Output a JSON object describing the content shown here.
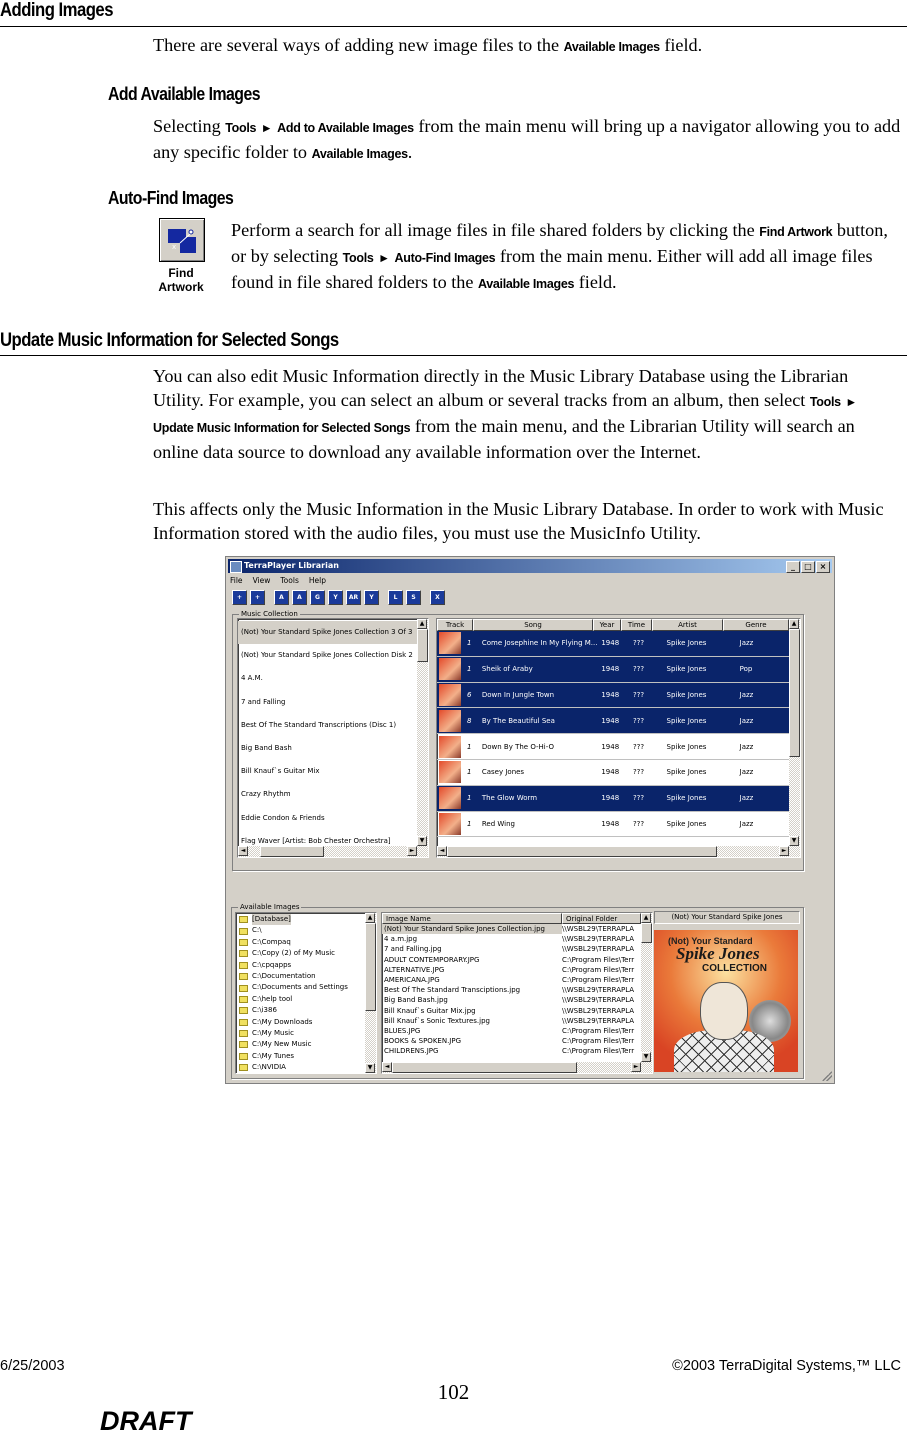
{
  "sections": {
    "adding_images": {
      "heading": "Adding Images",
      "intro_before": "There are several ways of adding new image files to the ",
      "intro_ui": "Available Images",
      "intro_after": " field."
    },
    "add_available": {
      "heading": "Add Available Images",
      "text1": "Selecting ",
      "ui_tools": "Tools",
      "arrow": "►",
      "ui_item": "Add to Available Images",
      "text2": " from the main menu will bring up a navigator allowing you to add any specific folder to ",
      "ui_target": "Available Images",
      "text3": "."
    },
    "auto_find": {
      "heading": "Auto-Find Images",
      "button_label": "Find Artwork",
      "button_icon": "find-artwork-icon",
      "text1": "Perform a search for all image files in file shared folders by clicking the ",
      "ui_button": "Find Artwork",
      "text2": " button, or by selecting ",
      "ui_tools": "Tools",
      "arrow": "►",
      "ui_item": "Auto-Find Images",
      "text3": " from the main menu.  Either will add all image files found in file shared folders to the ",
      "ui_target": "Available Images",
      "text4": " field."
    },
    "update_music": {
      "heading": "Update Music Information for Selected Songs",
      "p1_a": "You can also edit Music Information directly in the Music Library Database using the Librarian Utility.  For example, you can select an album or several tracks from an album, then select ",
      "ui_tools": "Tools",
      "arrow": "►",
      "ui_item": "Update Music Information for Selected Songs",
      "p1_b": " from the main menu, and the Librarian Utility will search an online data source to download any available information over the Internet.",
      "p2": "This affects only the Music Information in the Music Library Database.  In order to work with Music Information stored with the audio files, you must use the MusicInfo Utility."
    }
  },
  "window": {
    "title": "TerraPlayer Librarian",
    "controls": [
      "_",
      "□",
      "×"
    ],
    "menu": [
      "File",
      "View",
      "Tools",
      "Help"
    ],
    "toolbar": [
      "+",
      "+",
      "A",
      "A",
      "G",
      "Y",
      "AR",
      "Y",
      "L",
      "S",
      "X"
    ],
    "music_collection": {
      "label": "Music Collection",
      "items": [
        "(Not) Your Standard Spike Jones Collection 3 Of 3",
        "(Not) Your Standard Spike Jones Collection Disk 2",
        "4 A.M.",
        "7 and Falling",
        "Best Of The Standard Transcriptions (Disc 1)",
        "Big Band Bash",
        "Bill Knauf`s Guitar Mix",
        "Crazy Rhythm",
        "Eddie Condon & Friends",
        "Flag Waver [Artist: Bob Chester Orchestra]"
      ],
      "selected_index": 0
    },
    "tracks": {
      "columns": [
        "Track",
        "Song",
        "Year",
        "Time",
        "Artist",
        "Genre"
      ],
      "rows": [
        {
          "track": "1",
          "song": "Come Josephine In My Flying M...",
          "year": "1948",
          "time": "???",
          "artist": "Spike Jones",
          "genre": "Jazz",
          "selected": true
        },
        {
          "track": "1",
          "song": "Sheik of Araby",
          "year": "1948",
          "time": "???",
          "artist": "Spike Jones",
          "genre": "Pop",
          "selected": true
        },
        {
          "track": "6",
          "song": "Down In Jungle Town",
          "year": "1948",
          "time": "???",
          "artist": "Spike Jones",
          "genre": "Jazz",
          "selected": true
        },
        {
          "track": "8",
          "song": "By The Beautiful Sea",
          "year": "1948",
          "time": "???",
          "artist": "Spike Jones",
          "genre": "Jazz",
          "selected": true
        },
        {
          "track": "1",
          "song": "Down By The O-Hi-O",
          "year": "1948",
          "time": "???",
          "artist": "Spike Jones",
          "genre": "Jazz",
          "selected": false
        },
        {
          "track": "1",
          "song": "Casey Jones",
          "year": "1948",
          "time": "???",
          "artist": "Spike Jones",
          "genre": "Jazz",
          "selected": false
        },
        {
          "track": "1",
          "song": "The Glow Worm",
          "year": "1948",
          "time": "???",
          "artist": "Spike Jones",
          "genre": "Jazz",
          "selected": true
        },
        {
          "track": "1",
          "song": "Red Wing",
          "year": "1948",
          "time": "???",
          "artist": "Spike Jones",
          "genre": "Jazz",
          "selected": false
        }
      ]
    },
    "available_images": {
      "label": "Available Images",
      "folders": [
        "[Database]",
        "C:\\",
        "C:\\Compaq",
        "C:\\Copy (2) of My Music",
        "C:\\cpqapps",
        "C:\\Documentation",
        "C:\\Documents and Settings",
        "C:\\help tool",
        "C:\\i386",
        "C:\\My Downloads",
        "C:\\My Music",
        "C:\\My New Music",
        "C:\\My Tunes",
        "C:\\NVIDIA"
      ],
      "image_columns": [
        "Image Name",
        "Original Folder"
      ],
      "images": [
        {
          "name": "(Not) Your Standard Spike Jones Collection.jpg",
          "folder": "\\\\WSBL29\\TERRAPLA"
        },
        {
          "name": "4 a.m.jpg",
          "folder": "\\\\WSBL29\\TERRAPLA"
        },
        {
          "name": "7 and Falling.jpg",
          "folder": "\\\\WSBL29\\TERRAPLA"
        },
        {
          "name": "ADULT CONTEMPORARY.JPG",
          "folder": "C:\\Program Files\\Terr"
        },
        {
          "name": "ALTERNATIVE.JPG",
          "folder": "C:\\Program Files\\Terr"
        },
        {
          "name": "AMERICANA.JPG",
          "folder": "C:\\Program Files\\Terr"
        },
        {
          "name": "Best Of The Standard Transciptions.jpg",
          "folder": "\\\\WSBL29\\TERRAPLA"
        },
        {
          "name": "Big Band Bash.jpg",
          "folder": "\\\\WSBL29\\TERRAPLA"
        },
        {
          "name": "Bill Knauf`s Guitar Mix.jpg",
          "folder": "\\\\WSBL29\\TERRAPLA"
        },
        {
          "name": "Bill Knauf`s Sonic Textures.jpg",
          "folder": "\\\\WSBL29\\TERRAPLA"
        },
        {
          "name": "BLUES.JPG",
          "folder": "C:\\Program Files\\Terr"
        },
        {
          "name": "BOOKS & SPOKEN.JPG",
          "folder": "C:\\Program Files\\Terr"
        },
        {
          "name": "CHILDRENS.JPG",
          "folder": "C:\\Program Files\\Terr"
        }
      ],
      "preview_title": "(Not) Your Standard Spike Jones",
      "cover": {
        "line1": "(Not) Your Standard",
        "line2": "Spike Jones",
        "line3": "COLLECTION"
      }
    }
  },
  "footer": {
    "date": "6/25/2003",
    "copyright": "©2003 TerraDigital Systems,™ LLC",
    "page": "102",
    "draft": "DRAFT"
  }
}
